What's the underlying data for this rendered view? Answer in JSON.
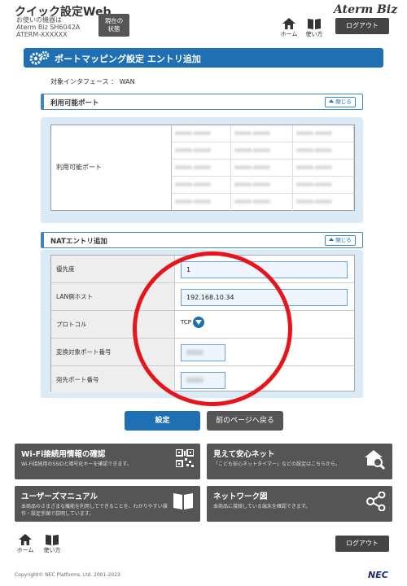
{
  "header": {
    "title": "クイック設定Web",
    "device_lines": [
      "お使いの機器は",
      "Aterm Biz SH6042A",
      "ATERM-XXXXXX"
    ],
    "status_button": "現在の\n状態",
    "home_label": "ホーム",
    "help_label": "使い方",
    "brand": "Aterm Biz",
    "logout": "ログアウト"
  },
  "page": {
    "title": "ポートマッピング設定 エントリ追加",
    "interface": "対象インタフェース ： WAN"
  },
  "ports_section": {
    "title": "利用可能ポート",
    "close": "閉じる",
    "row_label": "利用可能ポート",
    "cells": [
      [
        "00000-00000",
        "00000-00000",
        "00000-00000"
      ],
      [
        "00000-00000",
        "00000-00000",
        "00000-00000"
      ],
      [
        "00000-00000",
        "00000-00000",
        "00000-00000"
      ],
      [
        "00000-00000",
        "00000-00000",
        "00000-00000"
      ],
      [
        "00000-00000",
        "00000-00000",
        "00000-00000"
      ]
    ]
  },
  "nat_section": {
    "title": "NATエントリ追加",
    "close": "閉じる",
    "fields": [
      {
        "label": "優先度",
        "value": "1"
      },
      {
        "label": "LAN側ホスト",
        "value": "192.168.10.34"
      },
      {
        "label": "プロトコル",
        "value": "TCP"
      },
      {
        "label": "変換対象ポート番号",
        "value": "0000"
      },
      {
        "label": "宛先ポート番号",
        "value": "0000"
      }
    ]
  },
  "actions": {
    "set": "設定",
    "back": "前のページへ戻る"
  },
  "tiles": [
    {
      "title": "Wi-Fi接続用情報の確認",
      "desc": "Wi-Fi接続用のSSIDと暗号化キーを確認できます。",
      "icon": "qr-code-icon"
    },
    {
      "title": "見えて安心ネット",
      "desc": "「こども安心ネットタイマー」などの設定はこちらから。",
      "icon": "house-search-icon"
    },
    {
      "title": "ユーザーズマニュアル",
      "desc": "本商品のさまざまな機能を利用してできることを、わかりやすい操作・設定手順で説明しています。",
      "icon": "book-icon"
    },
    {
      "title": "ネットワーク図",
      "desc": "本商品に接続している端末を確認できます。",
      "icon": "network-share-icon"
    }
  ],
  "footer": {
    "home_label": "ホーム",
    "help_label": "使い方",
    "logout": "ログアウト",
    "copyright": "Copyright© NEC Platforms, Ltd. 2001-2023",
    "maker": "NEC"
  },
  "colors": {
    "accent": "#1f6fb5",
    "panel": "#dbeaf7",
    "dark_button": "#555555",
    "highlight_circle": "#e8141b"
  }
}
